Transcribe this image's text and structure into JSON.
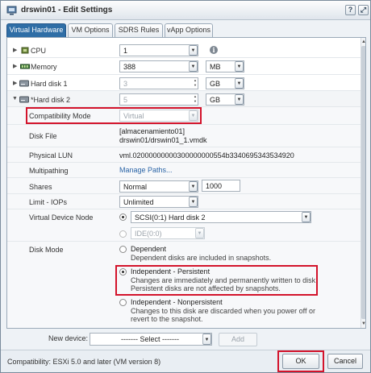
{
  "window": {
    "title": "drswin01 - Edit Settings",
    "help_label": "?",
    "maximize_label": "⤢"
  },
  "tabs": [
    {
      "label": "Virtual Hardware",
      "active": true
    },
    {
      "label": "VM Options",
      "active": false
    },
    {
      "label": "SDRS Rules",
      "active": false
    },
    {
      "label": "vApp Options",
      "active": false
    }
  ],
  "hardware": {
    "cpu": {
      "label": "CPU",
      "value": "1"
    },
    "memory": {
      "label": "Memory",
      "value": "388",
      "unit": "MB"
    },
    "hard_disk_1": {
      "label": "Hard disk 1",
      "value": "3",
      "unit": "GB"
    },
    "hard_disk_2": {
      "label": "*Hard disk 2",
      "value": "5",
      "unit": "GB",
      "compatibility_mode": {
        "label": "Compatibility Mode",
        "value": "Virtual"
      },
      "disk_file": {
        "label": "Disk File",
        "line1": "[almacenamiento01]",
        "line2": "drswin01/drswin01_1.vmdk"
      },
      "physical_lun": {
        "label": "Physical LUN",
        "value": "vml.02000000000300000000554b3340695343534920"
      },
      "multipathing": {
        "label": "Multipathing",
        "link": "Manage Paths..."
      },
      "shares": {
        "label": "Shares",
        "value": "Normal",
        "number": "1000"
      },
      "limit_iops": {
        "label": "Limit - IOPs",
        "value": "Unlimited"
      },
      "virtual_device_node": {
        "label": "Virtual Device Node",
        "scsi": "SCSI(0:1) Hard disk 2",
        "ide": "IDE(0:0)"
      },
      "disk_mode": {
        "label": "Disk Mode",
        "options": [
          {
            "title": "Dependent",
            "desc": [
              "Dependent disks are included in snapshots."
            ],
            "selected": false
          },
          {
            "title": "Independent - Persistent",
            "desc": [
              "Changes are immediately and permanently written to disk.",
              "Persistent disks are not affected by snapshots."
            ],
            "selected": true
          },
          {
            "title": "Independent - Nonpersistent",
            "desc": [
              "Changes to this disk are discarded when you power off or",
              "revert to the snapshot."
            ],
            "selected": false
          }
        ]
      }
    }
  },
  "new_device": {
    "label": "New device:",
    "select": "------- Select -------",
    "add": "Add"
  },
  "status": {
    "compatibility": "Compatibility: ESXi 5.0 and later (VM version 8)"
  },
  "buttons": {
    "ok": "OK",
    "cancel": "Cancel"
  },
  "colors": {
    "accent": "#2f6ea6",
    "highlight": "#d3132b"
  }
}
